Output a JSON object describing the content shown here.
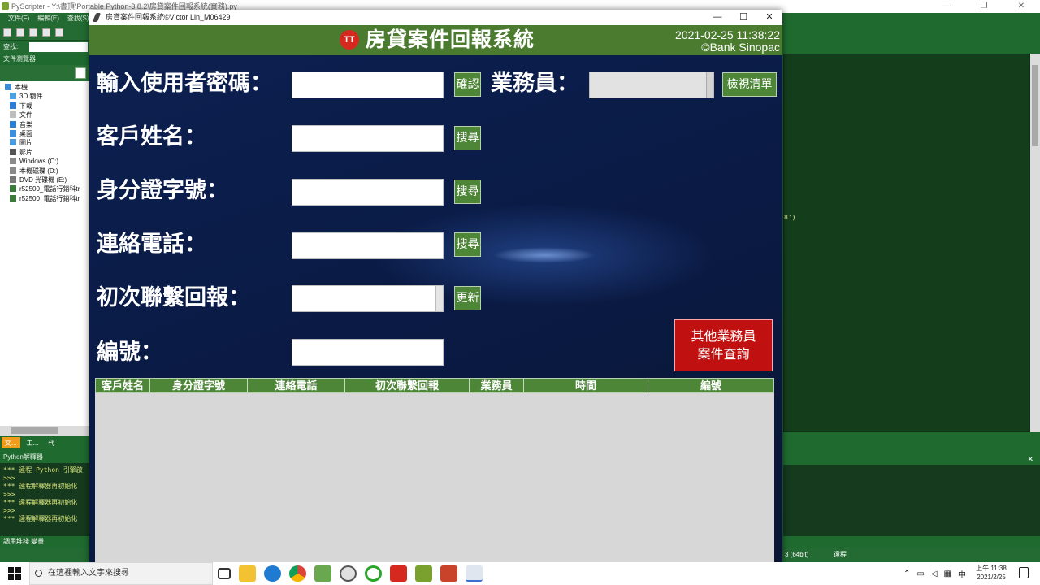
{
  "ide": {
    "title": "PyScripter - Y:\\書頂\\Portable Python-3.8.2\\房貸案件回報系統(實務).py",
    "menu": [
      "文件(F)",
      "編輯(E)",
      "查找(S)"
    ],
    "search_label": "查找:",
    "explorer_title": "文件瀏覽器",
    "tree": [
      "本機",
      "3D 物件",
      "下載",
      "文件",
      "音樂",
      "桌面",
      "圖片",
      "影片",
      "Windows (C:)",
      "本機磁碟 (D:)",
      "DVD 光碟機 (E:)",
      "r52500_電話行銷科tr",
      "r52500_電話行銷科tr"
    ],
    "tabs": [
      "文...",
      "工...",
      "代"
    ],
    "python_title": "Python解釋器",
    "console": [
      "*** 遠程 Python 引擎啟",
      ">>>",
      "*** 遠程解釋器再初始化",
      ">>>",
      "*** 遠程解釋器再初始化",
      ">>>",
      "*** 遠程解釋器再初始化"
    ],
    "bottom_tabs": "調用堆棧 變量",
    "status_bits": "3 (64bit)",
    "status_remote": "遠程",
    "code_fragment": "8')"
  },
  "window": {
    "title": "房貸案件回報系統©Victor Lin_M06429",
    "controls": [
      "—",
      "☐",
      "✕"
    ]
  },
  "header": {
    "logo_text": "TT",
    "title": "房貸案件回報系統",
    "datetime": "2021-02-25  11:38:22",
    "bank": "©Bank Sinopac"
  },
  "form": {
    "password_label": "輸入使用者密碼：",
    "confirm_btn": "確認",
    "sales_label": "業務員：",
    "view_list_btn": "檢視清單",
    "customer_label": "客戶姓名：",
    "search_btn": "搜尋",
    "id_label": "身分證字號：",
    "phone_label": "連絡電話：",
    "first_contact_label": "初次聯繫回報：",
    "update_btn": "更新",
    "number_label": "編號：",
    "other_sales_line1": "其他業務員",
    "other_sales_line2": "案件查詢"
  },
  "table": {
    "columns": [
      "客戶姓名",
      "身分證字號",
      "連絡電話",
      "初次聯繫回報",
      "業務員",
      "時間",
      "編號"
    ]
  },
  "taskbar": {
    "search_placeholder": "在這裡輸入文字來搜尋",
    "time": "上午 11:38",
    "date": "2021/2/25",
    "ime": "中"
  },
  "colors": {
    "header_green": "#4b7b2f",
    "button_green": "#4e8638",
    "alert_red": "#c0100f",
    "navy_bg": "#0a1a44"
  }
}
